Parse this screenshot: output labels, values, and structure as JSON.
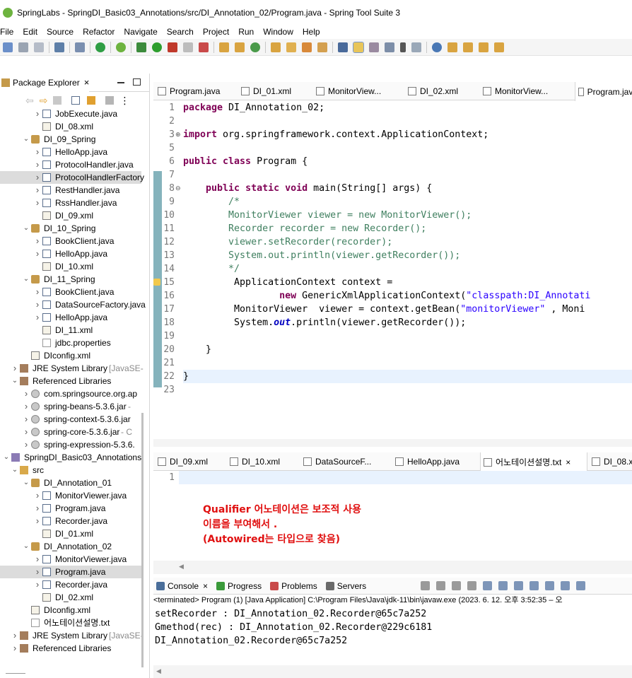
{
  "window": {
    "title": "SpringLabs - SpringDI_Basic03_Annotations/src/DI_Annotation_02/Program.java - Spring Tool Suite 3"
  },
  "menu": [
    "File",
    "Edit",
    "Source",
    "Refactor",
    "Navigate",
    "Search",
    "Project",
    "Run",
    "Window",
    "Help"
  ],
  "package_explorer": {
    "title": "Package Explorer",
    "tree": [
      {
        "label": "JobExecute.java",
        "icon": "java",
        "indent": 3,
        "twisty": "collapsed"
      },
      {
        "label": "DI_08.xml",
        "icon": "xml",
        "indent": 3,
        "twisty": ""
      },
      {
        "label": "DI_09_Spring",
        "icon": "pkg",
        "indent": 2,
        "twisty": "expanded"
      },
      {
        "label": "HelloApp.java",
        "icon": "java",
        "indent": 3,
        "twisty": "collapsed"
      },
      {
        "label": "ProtocolHandler.java",
        "icon": "java",
        "indent": 3,
        "twisty": "collapsed"
      },
      {
        "label": "ProtocolHandlerFactory",
        "icon": "java",
        "indent": 3,
        "twisty": "collapsed",
        "selected": true
      },
      {
        "label": "RestHandler.java",
        "icon": "java",
        "indent": 3,
        "twisty": "collapsed"
      },
      {
        "label": "RssHandler.java",
        "icon": "java",
        "indent": 3,
        "twisty": "collapsed"
      },
      {
        "label": "DI_09.xml",
        "icon": "xml",
        "indent": 3,
        "twisty": ""
      },
      {
        "label": "DI_10_Spring",
        "icon": "pkg",
        "indent": 2,
        "twisty": "expanded"
      },
      {
        "label": "BookClient.java",
        "icon": "java",
        "indent": 3,
        "twisty": "collapsed"
      },
      {
        "label": "HelloApp.java",
        "icon": "java",
        "indent": 3,
        "twisty": "collapsed"
      },
      {
        "label": "DI_10.xml",
        "icon": "xml",
        "indent": 3,
        "twisty": ""
      },
      {
        "label": "DI_11_Spring",
        "icon": "pkg",
        "indent": 2,
        "twisty": "expanded"
      },
      {
        "label": "BookClient.java",
        "icon": "java",
        "indent": 3,
        "twisty": "collapsed"
      },
      {
        "label": "DataSourceFactory.java",
        "icon": "java",
        "indent": 3,
        "twisty": "collapsed"
      },
      {
        "label": "HelloApp.java",
        "icon": "java",
        "indent": 3,
        "twisty": "collapsed"
      },
      {
        "label": "DI_11.xml",
        "icon": "xml",
        "indent": 3,
        "twisty": ""
      },
      {
        "label": "jdbc.properties",
        "icon": "txt",
        "indent": 3,
        "twisty": ""
      },
      {
        "label": "DIconfig.xml",
        "icon": "xml",
        "indent": 2,
        "twisty": ""
      },
      {
        "label": "JRE System Library",
        "suffix": "[JavaSE-",
        "icon": "lib",
        "indent": 1,
        "twisty": "collapsed"
      },
      {
        "label": "Referenced Libraries",
        "icon": "lib",
        "indent": 1,
        "twisty": "expanded"
      },
      {
        "label": "com.springsource.org.ap",
        "icon": "jar",
        "indent": 2,
        "twisty": "collapsed"
      },
      {
        "label": "spring-beans-5.3.6.jar",
        "suffix": " -",
        "icon": "jar",
        "indent": 2,
        "twisty": "collapsed"
      },
      {
        "label": "spring-context-5.3.6.jar",
        "icon": "jar",
        "indent": 2,
        "twisty": "collapsed"
      },
      {
        "label": "spring-core-5.3.6.jar",
        "suffix": " - C",
        "icon": "jar",
        "indent": 2,
        "twisty": "collapsed"
      },
      {
        "label": "spring-expression-5.3.6.",
        "icon": "jar",
        "indent": 2,
        "twisty": "collapsed"
      },
      {
        "label": "SpringDI_Basic03_Annotations",
        "icon": "proj",
        "indent": 0,
        "twisty": "expanded"
      },
      {
        "label": "src",
        "icon": "folder",
        "indent": 1,
        "twisty": "expanded"
      },
      {
        "label": "DI_Annotation_01",
        "icon": "pkg",
        "indent": 2,
        "twisty": "expanded"
      },
      {
        "label": "MonitorViewer.java",
        "icon": "java",
        "indent": 3,
        "twisty": "collapsed"
      },
      {
        "label": "Program.java",
        "icon": "java",
        "indent": 3,
        "twisty": "collapsed"
      },
      {
        "label": "Recorder.java",
        "icon": "java",
        "indent": 3,
        "twisty": "collapsed"
      },
      {
        "label": "DI_01.xml",
        "icon": "xml",
        "indent": 3,
        "twisty": ""
      },
      {
        "label": "DI_Annotation_02",
        "icon": "pkg",
        "indent": 2,
        "twisty": "expanded"
      },
      {
        "label": "MonitorViewer.java",
        "icon": "java",
        "indent": 3,
        "twisty": "collapsed"
      },
      {
        "label": "Program.java",
        "icon": "java",
        "indent": 3,
        "twisty": "collapsed",
        "selected": true
      },
      {
        "label": "Recorder.java",
        "icon": "java",
        "indent": 3,
        "twisty": "collapsed"
      },
      {
        "label": "DI_02.xml",
        "icon": "xml",
        "indent": 3,
        "twisty": ""
      },
      {
        "label": "DIconfig.xml",
        "icon": "xml",
        "indent": 2,
        "twisty": ""
      },
      {
        "label": "어노테이션설명.txt",
        "icon": "txt",
        "indent": 2,
        "twisty": ""
      },
      {
        "label": "JRE System Library",
        "suffix": "[JavaSE-",
        "icon": "lib",
        "indent": 1,
        "twisty": "collapsed"
      },
      {
        "label": "Referenced Libraries",
        "icon": "lib",
        "indent": 1,
        "twisty": "collapsed"
      }
    ]
  },
  "editor": {
    "tabs": [
      "Program.java",
      "DI_01.xml",
      "MonitorView...",
      "DI_02.xml",
      "MonitorView...",
      "Program.java"
    ],
    "line_numbers": [
      "1",
      "2",
      "3",
      "5",
      "6",
      "7",
      "8",
      "9",
      "10",
      "11",
      "12",
      "13",
      "14",
      "15",
      "16",
      "17",
      "18",
      "19",
      "20",
      "21",
      "22",
      "23"
    ],
    "lines": [
      [
        [
          "kw",
          "package"
        ],
        [
          "",
          "DI_Annotation_02;"
        ]
      ],
      [],
      [
        [
          "kw",
          "import"
        ],
        [
          "",
          "org.springframework.context.ApplicationContext;"
        ]
      ],
      [],
      [
        [
          "kw",
          "public class"
        ],
        [
          "",
          "Program {"
        ]
      ],
      [],
      [
        [
          "",
          "    "
        ],
        [
          "kw",
          "public static void"
        ],
        [
          "",
          "main(String[] args) {"
        ]
      ],
      [
        [
          "cm",
          "        /*"
        ]
      ],
      [
        [
          "cm",
          "        MonitorViewer viewer = new MonitorViewer();"
        ]
      ],
      [
        [
          "cm",
          "        Recorder recorder = new Recorder();"
        ]
      ],
      [
        [
          "cm",
          "        viewer.setRecorder(recorder);"
        ]
      ],
      [
        [
          "cm",
          "        System.out.println(viewer.getRecorder());"
        ]
      ],
      [
        [
          "cm",
          "        */"
        ]
      ],
      [
        [
          "",
          "         ApplicationContext context ="
        ]
      ],
      [
        [
          "",
          "                 "
        ],
        [
          "kw",
          "new"
        ],
        [
          "",
          "GenericXmlApplicationContext("
        ],
        [
          "st",
          "\"classpath:DI_Annotati"
        ]
      ],
      [
        [
          "",
          "         MonitorViewer  viewer = context.getBean("
        ],
        [
          "st",
          "\"monitorViewer\""
        ],
        [
          "",
          " , Moni"
        ]
      ],
      [
        [
          "",
          "         System."
        ],
        [
          "fld",
          "out"
        ],
        [
          "",
          ".println(viewer.getRecorder());"
        ]
      ],
      [],
      [
        [
          "",
          "    }"
        ]
      ],
      [],
      [
        [
          "",
          "}"
        ]
      ],
      []
    ]
  },
  "text_editor": {
    "tabs": [
      "DI_09.xml",
      "DI_10.xml",
      "DataSourceF...",
      "HelloApp.java",
      "어노테이션설명.txt",
      "DI_08.x"
    ],
    "line_number": "1",
    "memo": [
      "Qualifier 어노테이션은 보조적 사용",
      "이름을 부여해서 .",
      "(Autowired는 타입으로 찾음)"
    ]
  },
  "console": {
    "tabs": [
      "Console",
      "Progress",
      "Problems",
      "Servers"
    ],
    "status": "<terminated> Program (1) [Java Application] C:\\Program Files\\Java\\jdk-11\\bin\\javaw.exe  (2023. 6. 12. 오후 3:52:35 – 오",
    "output": [
      "setRecorder : DI_Annotation_02.Recorder@65c7a252",
      "Gmethod(rec) : DI_Annotation_02.Recorder@229c6181",
      "DI_Annotation_02.Recorder@65c7a252"
    ]
  },
  "colors": {
    "keyword": "#7f0055",
    "comment": "#3f7f5f",
    "string": "#2a00ff",
    "memo": "#e01010",
    "accent": "#6db33f"
  }
}
